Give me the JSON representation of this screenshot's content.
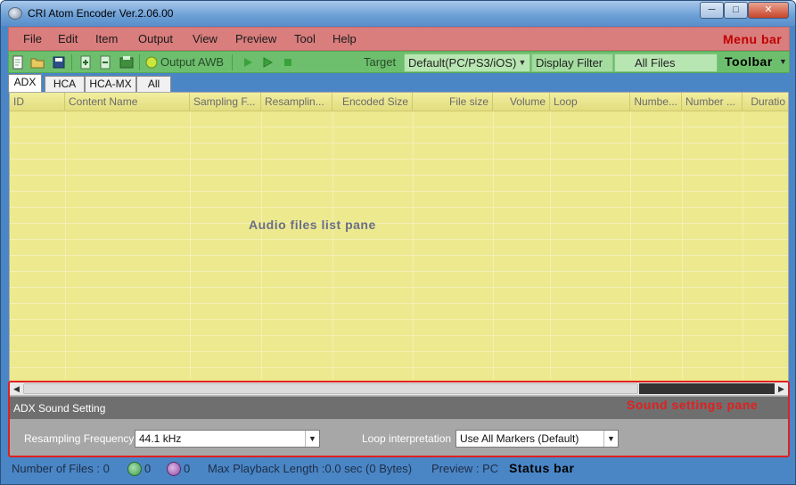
{
  "window": {
    "title": "CRI Atom Encoder Ver.2.06.00"
  },
  "controls": {
    "minimize": "─",
    "maximize": "□",
    "close": "✕"
  },
  "menubar": {
    "items": [
      "File",
      "Edit",
      "Item",
      "Output",
      "View",
      "Preview",
      "Tool",
      "Help"
    ],
    "label": "Menu bar"
  },
  "toolbar": {
    "output_awb": "Output AWB",
    "target_label": "Target",
    "target_value": "Default(PC/PS3/iOS)",
    "display_filter": "Display Filter",
    "filter_value": "All Files",
    "label": "Toolbar"
  },
  "tabs": [
    "ADX",
    "HCA",
    "HCA-MX",
    "All"
  ],
  "list": {
    "columns": [
      "ID",
      "Content Name",
      "Sampling F...",
      "Resamplin...",
      "Encoded Size",
      "File size",
      "Volume",
      "Loop",
      "Numbe...",
      "Number ...",
      "Duratio"
    ],
    "pane_label": "Audio files list pane"
  },
  "settings": {
    "title": "ADX  Sound Setting",
    "label": "Sound settings pane",
    "resampling_label": "Resampling Frequency",
    "resampling_value": "44.1 kHz",
    "loop_label": "Loop interpretation",
    "loop_value": "Use All Markers (Default)"
  },
  "status": {
    "files": "Number of Files : 0",
    "ok_count": "0",
    "err_count": "0",
    "max_playback": "Max Playback Length :0.0 sec (0 Bytes)",
    "preview": "Preview : PC",
    "label": "Status bar"
  },
  "colors": {
    "menubar": "#d97d7d",
    "toolbar": "#6dbf6d",
    "list": "#ede98f",
    "highlight": "#e02020",
    "status": "#4a86c6"
  }
}
